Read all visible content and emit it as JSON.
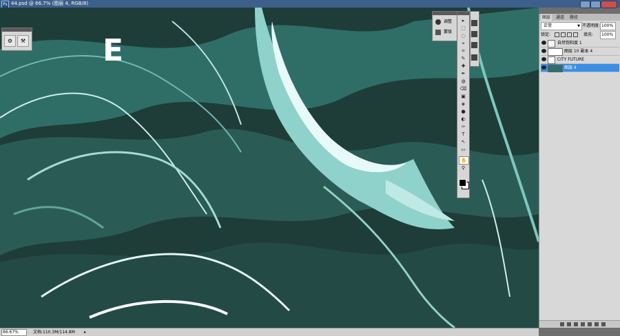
{
  "app": {
    "icon_label": "Ps",
    "title": "44.psd @ 66.7% (图层 4, RGB/8)"
  },
  "canvas": {
    "overlay_letter": "E"
  },
  "adjust_panel": {
    "items": [
      {
        "label": "调整",
        "icon": "adjust-icon"
      },
      {
        "label": "蒙版",
        "icon": "mask-icon"
      }
    ]
  },
  "tools": [
    "▸",
    "⬚",
    "◌",
    "⌖",
    "⌗",
    "✎",
    "✚",
    "✒",
    "◍",
    "⌫",
    "▣",
    "◈",
    "●",
    "◐",
    "✑",
    "T",
    "↖",
    "▭",
    "✋",
    "⚲"
  ],
  "layers_panel": {
    "tabs": [
      "图层",
      "通道",
      "路径"
    ],
    "blend_mode": "正常",
    "opacity_label": "不透明度:",
    "opacity_value": "100%",
    "lock_label": "锁定:",
    "fill_label": "填充:",
    "fill_value": "100%",
    "layers": [
      {
        "name": "自然饱和度 1",
        "thumb": "adjustment",
        "selected": false
      },
      {
        "name": "图层 10 副本 4",
        "thumb": "wide",
        "selected": false
      },
      {
        "name": "CITY FUTURE",
        "thumb": "text",
        "selected": false
      },
      {
        "name": "图层 4",
        "thumb": "image",
        "selected": true
      }
    ]
  },
  "status": {
    "zoom": "66.67%",
    "doc": "文档:110.3M/114.8M"
  },
  "colors": {
    "selection": "#3a8ee6",
    "canvas_base": "#1e3d38",
    "canvas_teal": "#5fb5ad"
  }
}
